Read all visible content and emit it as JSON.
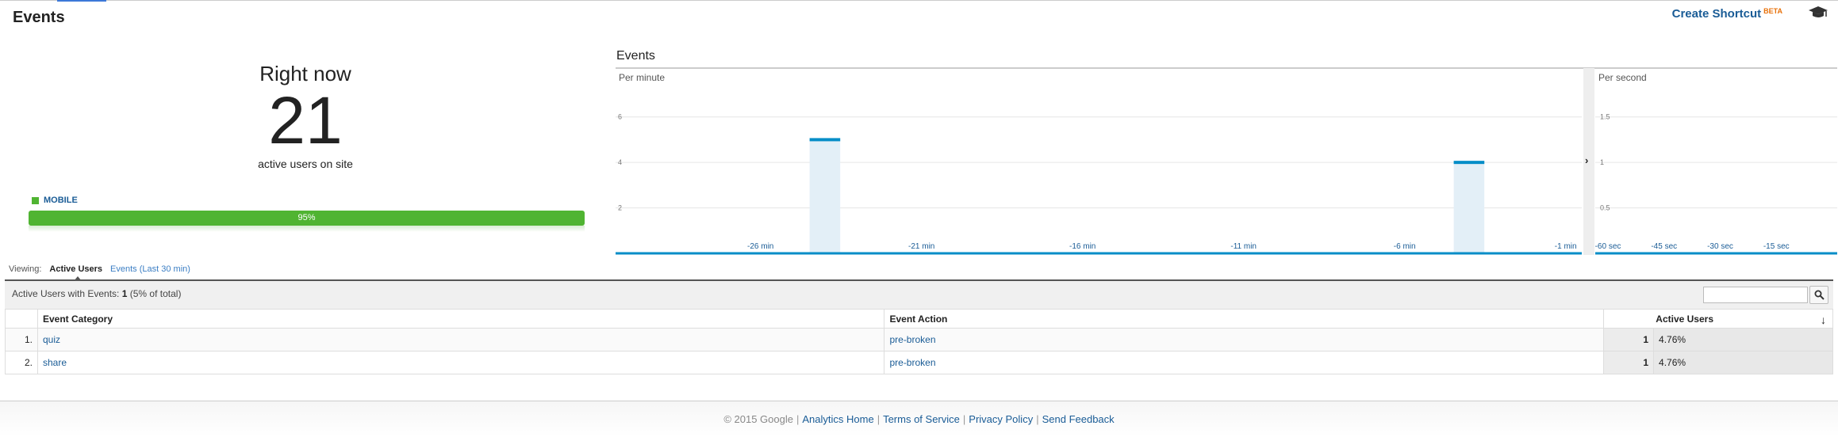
{
  "header": {
    "title": "Events",
    "shortcut_label": "Create Shortcut",
    "shortcut_badge": "BETA"
  },
  "right_now": {
    "title": "Right now",
    "count": "21",
    "subtitle": "active users on site",
    "legend_label": "MOBILE",
    "bar_label": "95%",
    "bar_fraction": 0.95,
    "bar_color": "#50b432"
  },
  "chart": {
    "label": "Events"
  },
  "chart_data": [
    {
      "type": "bar",
      "title": "Per minute",
      "x_ticks": [
        "-26 min",
        "-21 min",
        "-16 min",
        "-11 min",
        "-6 min",
        "-1 min"
      ],
      "y_ticks": [
        "2",
        "4",
        "6"
      ],
      "ylim": [
        0,
        7
      ],
      "x": [
        -30,
        -29,
        -28,
        -27,
        -26,
        -25,
        -24,
        -23,
        -22,
        -21,
        -20,
        -19,
        -18,
        -17,
        -16,
        -15,
        -14,
        -13,
        -12,
        -11,
        -10,
        -9,
        -8,
        -7,
        -6,
        -5,
        -4,
        -3,
        -2,
        -1
      ],
      "values": [
        0,
        0,
        0,
        0,
        0,
        0,
        5,
        0,
        0,
        0,
        0,
        0,
        0,
        0,
        0,
        0,
        0,
        0,
        0,
        0,
        0,
        0,
        0,
        0,
        0,
        0,
        4,
        0,
        0,
        0
      ],
      "grid": true,
      "color": "#058dc7"
    },
    {
      "type": "bar",
      "title": "Per second",
      "x_ticks": [
        "-60 sec",
        "-45 sec",
        "-30 sec",
        "-15 sec"
      ],
      "y_ticks": [
        "0.5",
        "1",
        "1.5"
      ],
      "ylim": [
        0,
        1.75
      ],
      "values": [],
      "grid": true,
      "color": "#058dc7"
    }
  ],
  "viewing": {
    "label": "Viewing:",
    "tabs": [
      {
        "label": "Active Users"
      },
      {
        "label": "Events (Last 30 min)"
      }
    ]
  },
  "table": {
    "summary_prefix": "Active Users with Events:",
    "summary_value": "1",
    "summary_suffix": "(5% of total)",
    "headers": {
      "category": "Event Category",
      "action": "Event Action",
      "users": "Active Users"
    },
    "rows": [
      {
        "num": "1.",
        "category": "quiz",
        "action": "pre-broken",
        "users": "1",
        "pct": "4.76%"
      },
      {
        "num": "2.",
        "category": "share",
        "action": "pre-broken",
        "users": "1",
        "pct": "4.76%"
      }
    ]
  },
  "footer": {
    "copyright": "© 2015 Google",
    "links": [
      "Analytics Home",
      "Terms of Service",
      "Privacy Policy",
      "Send Feedback"
    ]
  }
}
